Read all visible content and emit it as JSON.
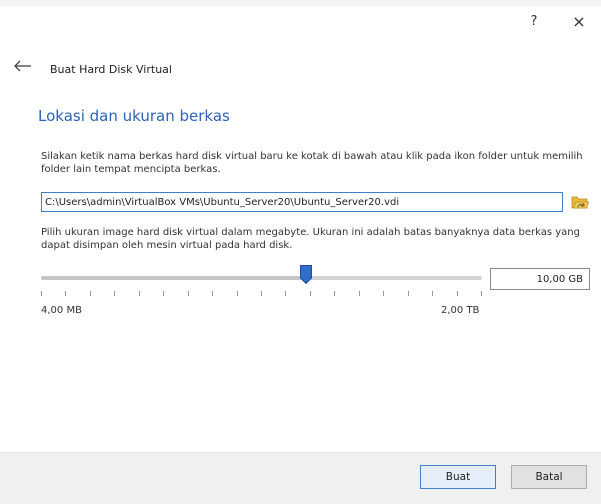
{
  "window": {
    "help_label": "?",
    "close_label": "×"
  },
  "header": {
    "wizard_title": "Buat Hard Disk Virtual"
  },
  "section": {
    "title": "Lokasi dan ukuran berkas"
  },
  "location": {
    "description": "Silakan ketik nama berkas hard disk virtual baru ke kotak di bawah atau klik pada ikon folder untuk memilih folder lain tempat mencipta berkas.",
    "path_value": "C:\\Users\\admin\\VirtualBox VMs\\Ubuntu_Server20\\Ubuntu_Server20.vdi",
    "folder_icon": "folder-open-icon"
  },
  "size": {
    "description": "Pilih ukuran image hard disk virtual dalam megabyte. Ukuran ini adalah batas banyaknya data berkas yang dapat disimpan oleh mesin virtual pada hard disk.",
    "value": "10,00 GB",
    "min_label": "4,00 MB",
    "max_label": "2,00 TB",
    "slider_position": 0.6,
    "tick_count": 19
  },
  "buttons": {
    "create": "Buat",
    "cancel": "Batal"
  },
  "colors": {
    "accent": "#2b63b8",
    "focus_border": "#3f7fd0",
    "slider_thumb": "#2f6fc9"
  }
}
